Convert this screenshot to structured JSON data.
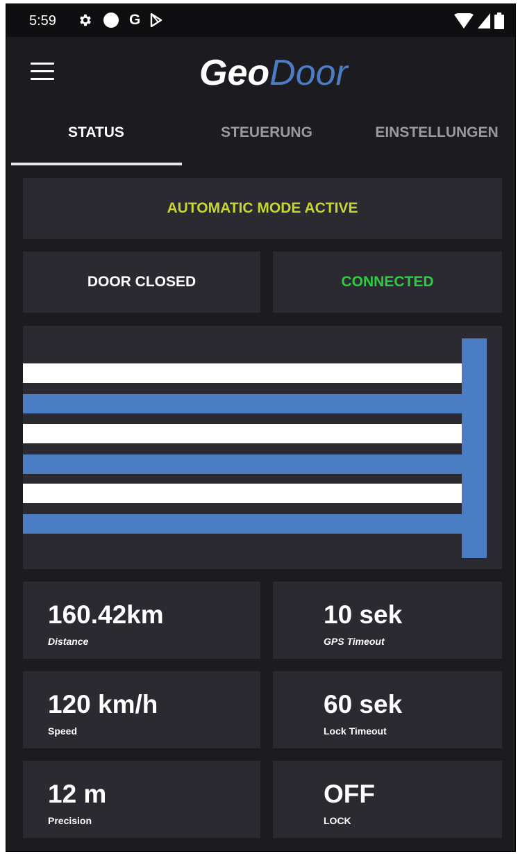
{
  "statusbar": {
    "time": "5:59",
    "icons": [
      "gear-icon",
      "circle-icon",
      "google-icon",
      "play-store-icon",
      "wifi-icon",
      "signal-icon",
      "battery-icon"
    ],
    "google_letter": "G"
  },
  "appbar": {
    "logo_part1": "Geo",
    "logo_part2": "Door",
    "accent_color": "#4a7dc4"
  },
  "tabs": [
    {
      "label": "STATUS",
      "active": true
    },
    {
      "label": "STEUERUNG",
      "active": false
    },
    {
      "label": "EINSTELLUNGEN",
      "active": false
    }
  ],
  "status": {
    "mode": "AUTOMATIC MODE ACTIVE",
    "mode_color": "#c8d62e",
    "door": "DOOR CLOSED",
    "connection": "CONNECTED",
    "connection_color": "#2ecc40"
  },
  "metrics": [
    {
      "value": "160.42km",
      "label": "Distance"
    },
    {
      "value": "10 sek",
      "label": "GPS Timeout"
    },
    {
      "value": "120 km/h",
      "label": "Speed"
    },
    {
      "value": "60 sek",
      "label": "Lock Timeout"
    },
    {
      "value": "12 m",
      "label": "Precision"
    },
    {
      "value": "OFF",
      "label": "LOCK"
    }
  ]
}
